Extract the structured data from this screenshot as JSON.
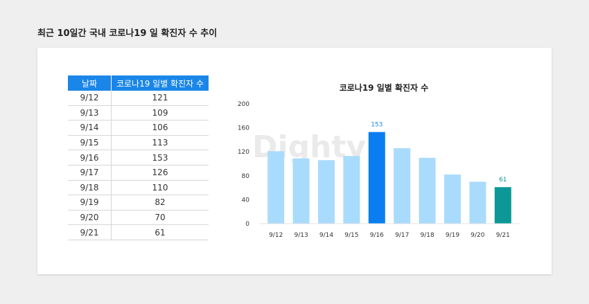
{
  "page_title": "최근 10일간 국내 코로나19 일 확진자 수 추이",
  "table": {
    "headers": [
      "날짜",
      "코로나19 일별 확진자 수"
    ],
    "rows": [
      [
        "9/12",
        "121"
      ],
      [
        "9/13",
        "109"
      ],
      [
        "9/14",
        "106"
      ],
      [
        "9/15",
        "113"
      ],
      [
        "9/16",
        "153"
      ],
      [
        "9/17",
        "126"
      ],
      [
        "9/18",
        "110"
      ],
      [
        "9/19",
        "82"
      ],
      [
        "9/20",
        "70"
      ],
      [
        "9/21",
        "61"
      ]
    ]
  },
  "watermark": "Dighty",
  "colors": {
    "default_bar": "#a9dbfc",
    "max_bar": "#0a7ef0",
    "latest_bar": "#0b9896",
    "max_label": "#1a86e8",
    "latest_label": "#0b9896",
    "header_bg": "#1a86e8"
  },
  "chart_data": {
    "type": "bar",
    "title": "코로나19 일별 확진자 수",
    "categories": [
      "9/12",
      "9/13",
      "9/14",
      "9/15",
      "9/16",
      "9/17",
      "9/18",
      "9/19",
      "9/20",
      "9/21"
    ],
    "values": [
      121,
      109,
      106,
      113,
      153,
      126,
      110,
      82,
      70,
      61
    ],
    "ylim": [
      0,
      200
    ],
    "yticks": [
      0,
      40,
      80,
      120,
      160,
      200
    ],
    "highlight": {
      "max_index": 4,
      "latest_index": 9
    },
    "data_labels": [
      {
        "index": 4,
        "text": "153"
      },
      {
        "index": 9,
        "text": "61"
      }
    ],
    "grid": false,
    "legend": "none"
  }
}
